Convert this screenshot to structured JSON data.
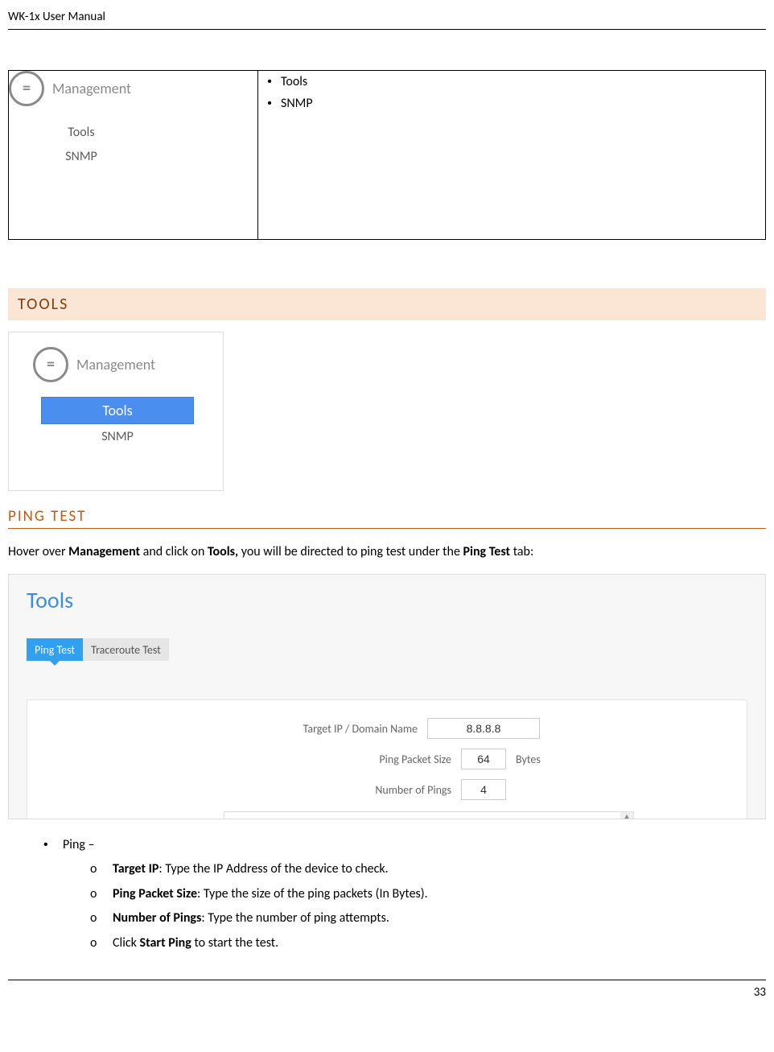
{
  "header": {
    "title": "WK-1x User Manual"
  },
  "mgmt_table": {
    "icon_label": "Management",
    "sub_items": [
      "Tools",
      "SNMP"
    ],
    "right_items": [
      "Tools",
      "SNMP"
    ]
  },
  "tools_section": {
    "heading": "TOOLS"
  },
  "mgmt_block2": {
    "icon_label": "Management",
    "highlight": "Tools",
    "other": "SNMP"
  },
  "pingtest": {
    "heading": "PING TEST",
    "intro_pre": "Hover over ",
    "intro_b1": "Management",
    "intro_mid1": " and click on ",
    "intro_b2": "Tools,",
    "intro_mid2": " you will be directed to ping test under the ",
    "intro_b3": "Ping Test",
    "intro_post": " tab:"
  },
  "tools_panel": {
    "title": "Tools",
    "tabs": {
      "active": "Ping Test",
      "inactive": "Traceroute Test"
    },
    "form": {
      "target_label": "Target IP / Domain Name",
      "target_value": "8.8.8.8",
      "size_label": "Ping Packet Size",
      "size_value": "64",
      "size_unit": "Bytes",
      "count_label": "Number of Pings",
      "count_value": "4"
    }
  },
  "bullets": {
    "top": "Ping –",
    "items": [
      {
        "b": "Target IP",
        "rest": ": Type the IP Address of the device to check."
      },
      {
        "b": "Ping Packet Size",
        "rest": ": Type the size of the ping packets (In Bytes)."
      },
      {
        "b": "Number of Pings",
        "rest": ": Type the number of ping attempts."
      },
      {
        "pre": "Click ",
        "b": "Start Ping",
        "rest": " to start the test."
      }
    ]
  },
  "footer": {
    "page": "33"
  }
}
